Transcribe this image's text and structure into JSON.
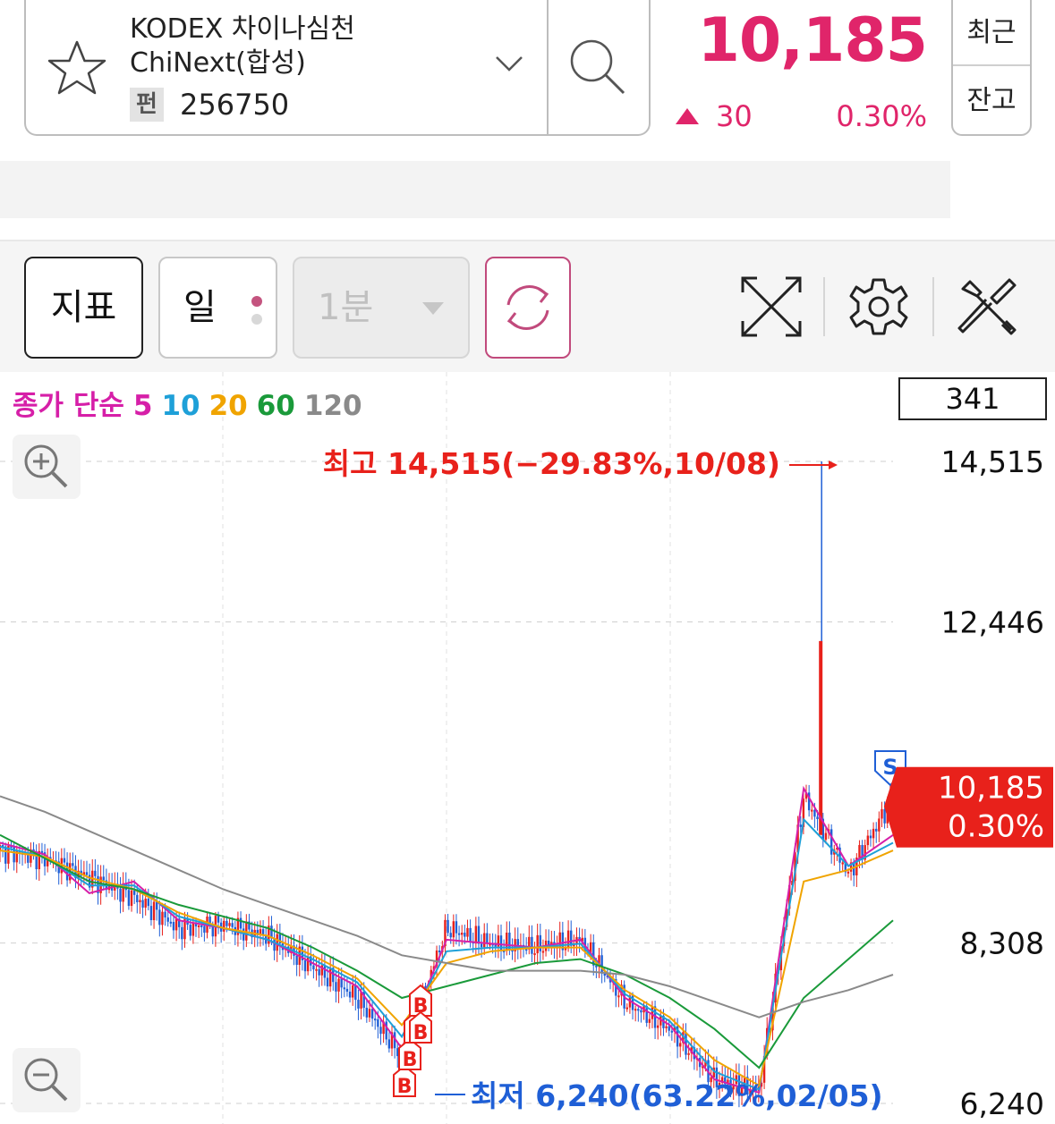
{
  "stock": {
    "name_line1": "KODEX 차이나심천",
    "name_line2": "ChiNext(합성)",
    "badge": "펀",
    "code": "256750",
    "price": "10,185",
    "change": "30",
    "change_rate": "0.30%",
    "direction": "up",
    "accent_color": "#e0256a"
  },
  "quote_toggle": {
    "recent": "최근",
    "balance": "잔고"
  },
  "toolbar": {
    "indicator_label": "지표",
    "period_label": "일",
    "minute_label": "1분",
    "icons": [
      "refresh-icon",
      "fullscreen-icon",
      "settings-icon",
      "tools-icon"
    ]
  },
  "chart": {
    "legend": {
      "prefix": "종가 단순",
      "periods": [
        {
          "label": "5",
          "color": "#d61fa8"
        },
        {
          "label": "10",
          "color": "#1ea0d8"
        },
        {
          "label": "20",
          "color": "#f0a400"
        },
        {
          "label": "60",
          "color": "#1a9a3a"
        },
        {
          "label": "120",
          "color": "#8a8a8a"
        }
      ]
    },
    "count": "341",
    "y_labels": [
      "14,515",
      "12,446",
      "8,308",
      "6,240"
    ],
    "current_price_label": "10,185",
    "current_rate_label": "0.30%",
    "high_annotation": "최고 14,515(−29.83%,10/08)",
    "low_annotation": "최저 6,240(63.22%,02/05)",
    "buy_marker": "B",
    "sell_marker": "S",
    "up_color": "#e8211b",
    "down_color": "#1f5fd6"
  },
  "chart_data": {
    "type": "line",
    "series": [
      {
        "name": "5",
        "values": [
          9600,
          9450,
          8950,
          9100,
          8600,
          8500,
          8350,
          8050,
          7750,
          6950,
          8350,
          8300,
          8250,
          8350,
          7600,
          7250,
          6550,
          6380,
          10300,
          9300,
          9700
        ]
      },
      {
        "name": "10",
        "values": [
          9550,
          9420,
          9050,
          9050,
          8650,
          8500,
          8350,
          8100,
          7800,
          7100,
          8200,
          8250,
          8250,
          8300,
          7650,
          7300,
          6650,
          6420,
          9900,
          9300,
          9600
        ]
      },
      {
        "name": "20",
        "values": [
          9500,
          9420,
          9150,
          9000,
          8700,
          8500,
          8400,
          8150,
          7850,
          7250,
          8050,
          8200,
          8250,
          8250,
          7700,
          7350,
          6800,
          6470,
          9100,
          9250,
          9500
        ]
      },
      {
        "name": "60",
        "values": [
          9700,
          9400,
          9100,
          9000,
          8800,
          8650,
          8500,
          8250,
          7950,
          7600,
          7750,
          7900,
          8050,
          8100,
          7900,
          7600,
          7200,
          6700,
          7600,
          8100,
          8600
        ]
      },
      {
        "name": "120",
        "values": [
          10200,
          10000,
          9750,
          9500,
          9250,
          9000,
          8800,
          8600,
          8400,
          8150,
          8050,
          7950,
          7950,
          7950,
          7900,
          7750,
          7550,
          7350,
          7550,
          7700,
          7900
        ]
      }
    ],
    "close": [
      9500,
      9400,
      9150,
      8900,
      8500,
      8550,
      8400,
      8000,
      7600,
      6850,
      8500,
      8300,
      8250,
      8350,
      7550,
      7200,
      6550,
      6400,
      10200,
      9200,
      10185
    ],
    "ylim": [
      6240,
      14515
    ],
    "high": 14515,
    "low": 6240
  }
}
